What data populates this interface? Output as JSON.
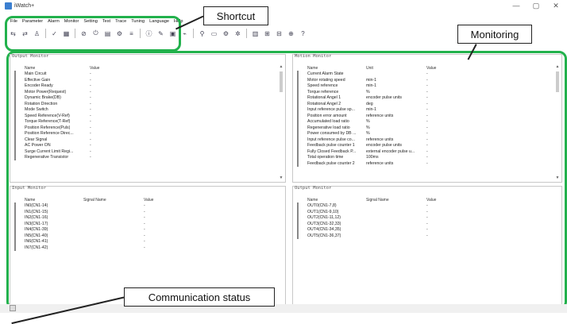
{
  "window": {
    "title": "iWatch+",
    "minimize_icon": "—",
    "maximize_icon": "▢",
    "close_icon": "✕"
  },
  "menu": [
    "File",
    "Parameter",
    "Alarm",
    "Monitor",
    "Setting",
    "Test",
    "Trace",
    "Tuning",
    "Language",
    "Help"
  ],
  "toolbar_icons": [
    "connect-icon",
    "disconnect-icon",
    "user-icon",
    "check-icon",
    "table-icon",
    "stop-icon",
    "power-icon",
    "save-icon",
    "settings-icon",
    "trace-icon",
    "info-icon",
    "tune-icon",
    "lock-icon",
    "sweep-icon",
    "run-icon",
    "monitor-icon",
    "gear-icon",
    "gear-alt-icon",
    "display-icon",
    "chart-icon",
    "io-icon",
    "scope-icon",
    "help-icon"
  ],
  "callouts": {
    "shortcut": "Shortcut",
    "monitoring": "Monitoring",
    "communication": "Communication status"
  },
  "output_monitor_top": {
    "title": "Output Monitor",
    "headers": {
      "name": "Name",
      "value": "Value"
    },
    "rows": [
      {
        "name": "Main Circuit",
        "value": "-"
      },
      {
        "name": "Effective Gain",
        "value": "-"
      },
      {
        "name": "Encoder Ready",
        "value": "-"
      },
      {
        "name": "Motor Power(Request)",
        "value": "-"
      },
      {
        "name": "Dynamic Brake(DB)",
        "value": "-"
      },
      {
        "name": "Rotation Direction",
        "value": "-"
      },
      {
        "name": "Mode Switch",
        "value": "-"
      },
      {
        "name": "Speed Reference(V-Ref)",
        "value": "-"
      },
      {
        "name": "Torque Reference(T-Ref)",
        "value": "-"
      },
      {
        "name": "Position Reference(Puls)",
        "value": "-"
      },
      {
        "name": "Position Reference Direc...",
        "value": "-"
      },
      {
        "name": "Clear Signal",
        "value": "-"
      },
      {
        "name": "AC Power ON",
        "value": "-"
      },
      {
        "name": "Surge Current Limit Regi...",
        "value": "-"
      },
      {
        "name": "Regenerative Transistor",
        "value": "-"
      }
    ]
  },
  "motion_monitor": {
    "title": "Motion Monitor",
    "headers": {
      "name": "Name",
      "unit": "Unit",
      "value": "Value"
    },
    "rows": [
      {
        "name": "Current Alarm State",
        "unit": "",
        "value": "-"
      },
      {
        "name": "Motor rotating speed",
        "unit": "min-1",
        "value": "-"
      },
      {
        "name": "Speed reference",
        "unit": "min-1",
        "value": "-"
      },
      {
        "name": "Torque reference",
        "unit": "%",
        "value": "-"
      },
      {
        "name": "Rotational Angel 1",
        "unit": "encoder pulse units",
        "value": "-"
      },
      {
        "name": "Rotational Angel 2",
        "unit": "deg",
        "value": "-"
      },
      {
        "name": "Input reference pulse sp...",
        "unit": "min-1",
        "value": "-"
      },
      {
        "name": "Position error amount",
        "unit": "reference units",
        "value": "-"
      },
      {
        "name": "Accumulated load ratio",
        "unit": "%",
        "value": "-"
      },
      {
        "name": "Regenerative load ratio",
        "unit": "%",
        "value": "-"
      },
      {
        "name": "Power consumed by DB ...",
        "unit": "%",
        "value": "-"
      },
      {
        "name": "Input reference pulse co...",
        "unit": "reference units",
        "value": "-"
      },
      {
        "name": "Feedback pulse counter 1",
        "unit": "encoder pulse units",
        "value": "-"
      },
      {
        "name": "Fully Closed Feedback P...",
        "unit": "external encoder pulse u...",
        "value": "-"
      },
      {
        "name": "Total operation time",
        "unit": "100ms",
        "value": "-"
      },
      {
        "name": "Feedback pulse counter 2",
        "unit": "reference units",
        "value": "-"
      }
    ]
  },
  "input_monitor": {
    "title": "Input Monitor",
    "headers": {
      "name": "Name",
      "signal": "Signal Name",
      "value": "Value"
    },
    "rows": [
      {
        "name": "IN0(CN1-14)",
        "signal": "",
        "value": "-"
      },
      {
        "name": "IN1(CN1-15)",
        "signal": "",
        "value": "-"
      },
      {
        "name": "IN2(CN1-16)",
        "signal": "",
        "value": "-"
      },
      {
        "name": "IN3(CN1-17)",
        "signal": "",
        "value": "-"
      },
      {
        "name": "IN4(CN1-39)",
        "signal": "",
        "value": "-"
      },
      {
        "name": "IN5(CN1-40)",
        "signal": "",
        "value": "-"
      },
      {
        "name": "IN6(CN1-41)",
        "signal": "",
        "value": "-"
      },
      {
        "name": "IN7(CN1-42)",
        "signal": "",
        "value": "-"
      }
    ]
  },
  "output_monitor_bottom": {
    "title": "Output Monitor",
    "headers": {
      "name": "Name",
      "signal": "Signal Name",
      "value": "Value"
    },
    "rows": [
      {
        "name": "OUT0(CN1-7,8)",
        "signal": "",
        "value": "-"
      },
      {
        "name": "OUT1(CN1-9,10)",
        "signal": "",
        "value": "-"
      },
      {
        "name": "OUT2(CN1-11,12)",
        "signal": "",
        "value": "-"
      },
      {
        "name": "OUT3(CN1-32,33)",
        "signal": "",
        "value": "-"
      },
      {
        "name": "OUT4(CN1-34,35)",
        "signal": "",
        "value": "-"
      },
      {
        "name": "OUT5(CN1-36,37)",
        "signal": "",
        "value": "-"
      }
    ]
  }
}
